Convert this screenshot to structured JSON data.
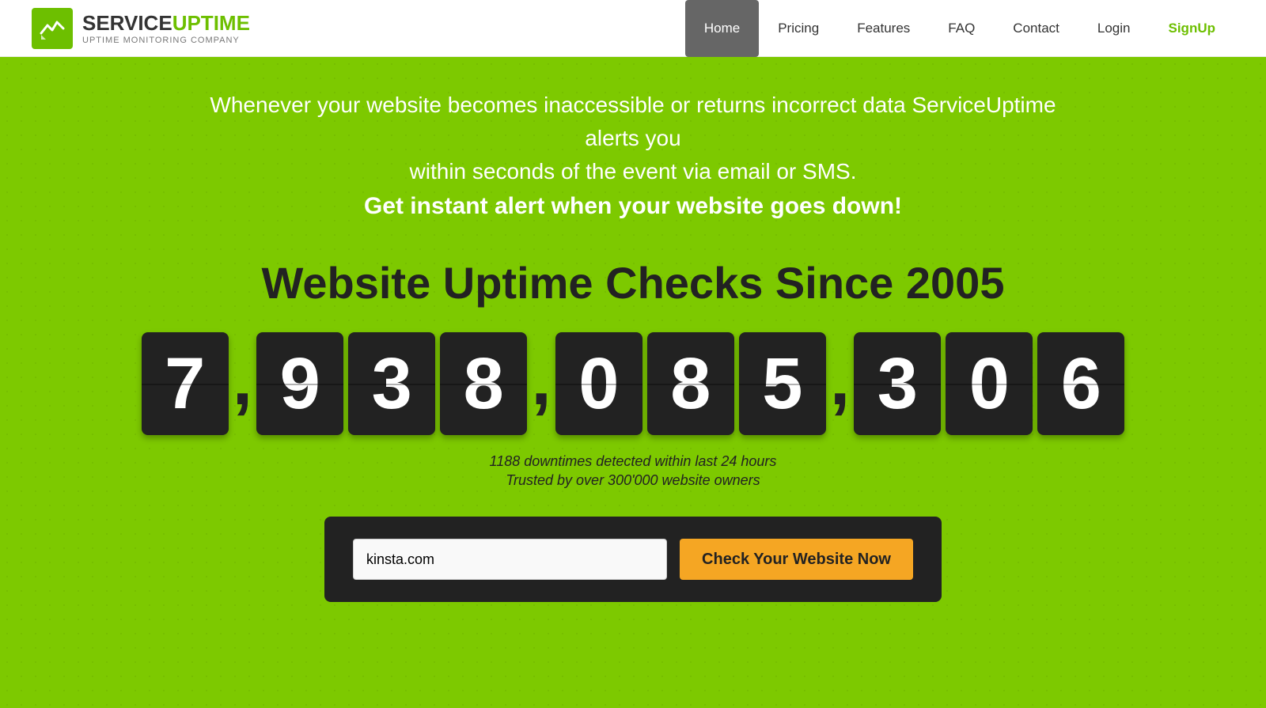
{
  "brand": {
    "name_prefix": "SERVICE",
    "name_suffix": "UPTIME",
    "tagline": "UPTIME MONITORING COMPANY",
    "logo_icon": "chart-line"
  },
  "nav": {
    "items": [
      {
        "label": "Home",
        "active": true,
        "id": "home"
      },
      {
        "label": "Pricing",
        "active": false,
        "id": "pricing"
      },
      {
        "label": "Features",
        "active": false,
        "id": "features"
      },
      {
        "label": "FAQ",
        "active": false,
        "id": "faq"
      },
      {
        "label": "Contact",
        "active": false,
        "id": "contact"
      },
      {
        "label": "Login",
        "active": false,
        "id": "login"
      },
      {
        "label": "SignUp",
        "active": false,
        "id": "signup",
        "special": true
      }
    ]
  },
  "hero": {
    "description_line1": "Whenever your website becomes inaccessible or returns incorrect data ServiceUptime alerts you",
    "description_line2": "within seconds of the event via email or SMS.",
    "cta_text": "Get instant alert when your website goes down!",
    "heading": "Website Uptime Checks Since 2005",
    "counter": {
      "digits": [
        "7",
        "9",
        "3",
        "8",
        "0",
        "8",
        "5",
        "3",
        "0",
        "6"
      ],
      "display": "7,938,085,306"
    },
    "stat1": "1188 downtimes detected within last 24 hours",
    "stat2": "Trusted by over 300'000 website owners",
    "input_placeholder": "kinsta.com",
    "input_value": "kinsta.com",
    "button_label": "Check Your Website Now"
  }
}
